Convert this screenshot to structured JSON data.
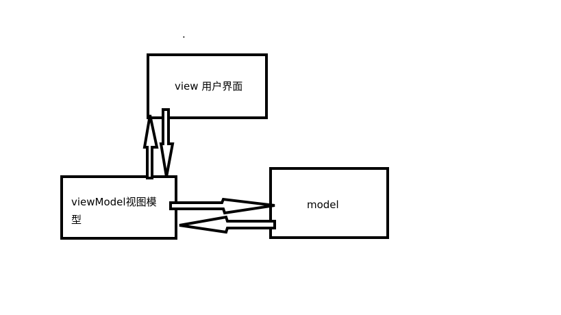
{
  "nodes": {
    "view": {
      "label": "view 用户界面"
    },
    "viewmodel": {
      "label_line1": "viewModel视图模",
      "label_line2": "型"
    },
    "model": {
      "label": "model"
    }
  },
  "stray_mark": "."
}
